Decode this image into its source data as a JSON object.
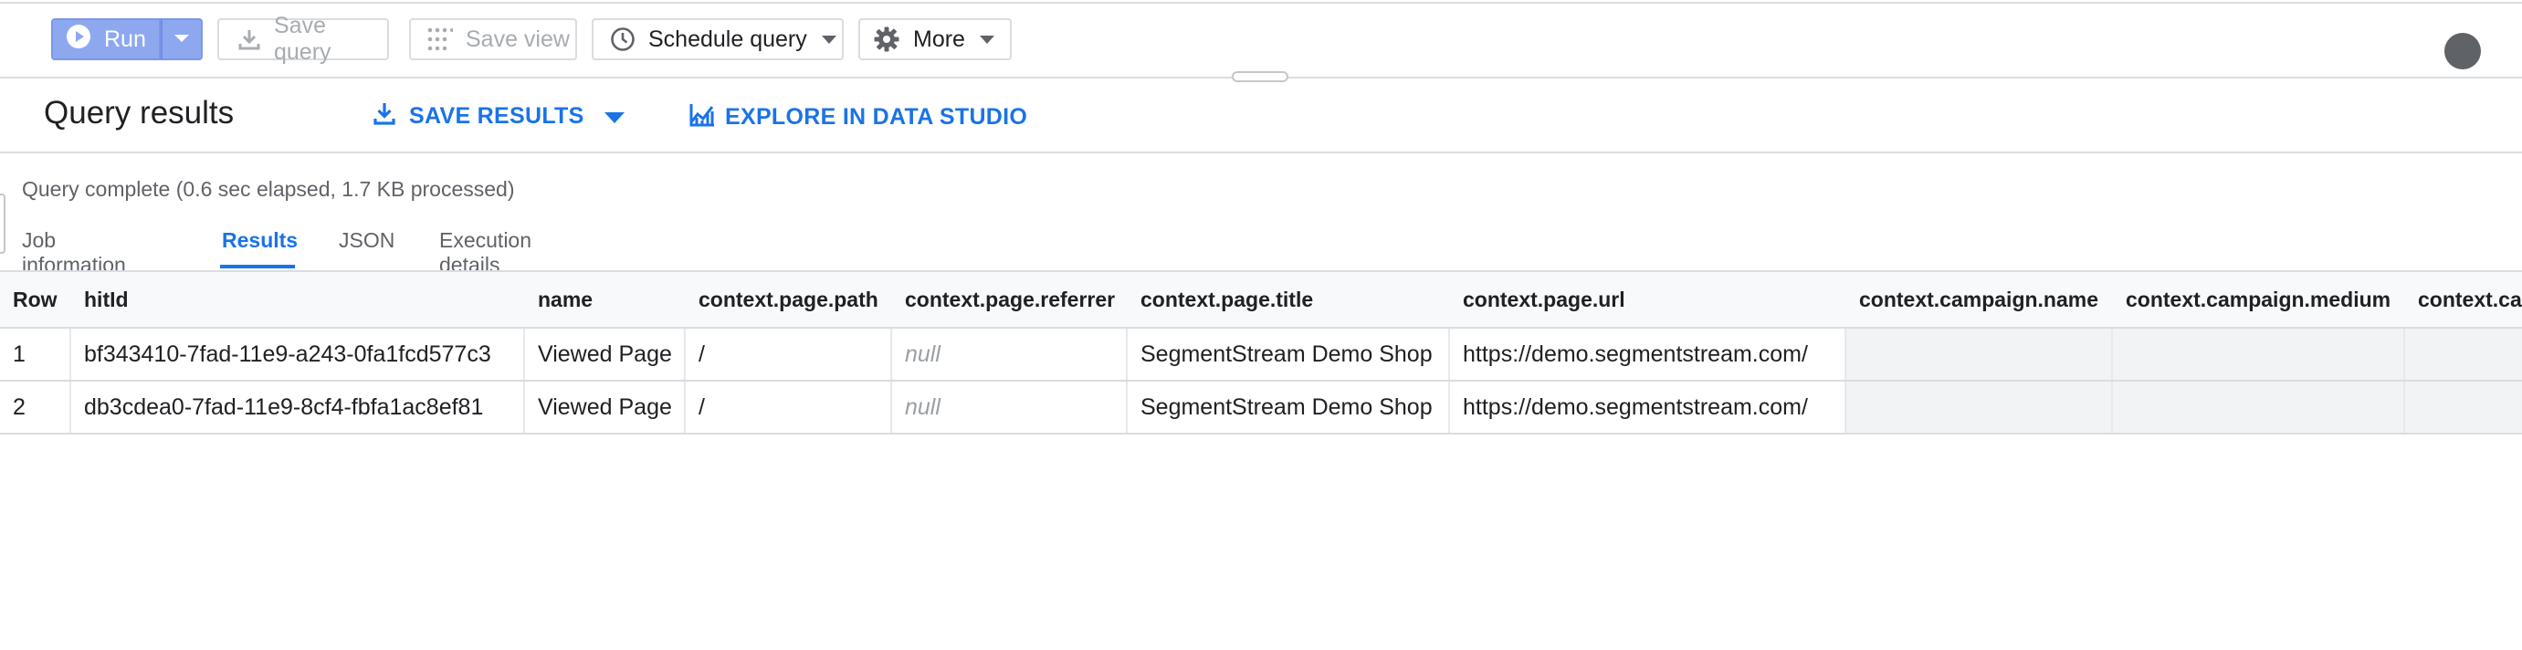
{
  "toolbar": {
    "run_label": "Run",
    "save_query_label": "Save query",
    "save_view_label": "Save view",
    "schedule_label": "Schedule query",
    "more_label": "More"
  },
  "results_header": {
    "title": "Query results",
    "save_results_label": "SAVE RESULTS",
    "explore_label": "EXPLORE IN DATA STUDIO"
  },
  "status_text": "Query complete (0.6 sec elapsed, 1.7 KB processed)",
  "tabs": [
    {
      "label": "Job information"
    },
    {
      "label": "Results"
    },
    {
      "label": "JSON"
    },
    {
      "label": "Execution details"
    }
  ],
  "active_tab": "Results",
  "table": {
    "columns": [
      "Row",
      "hitId",
      "name",
      "context.page.path",
      "context.page.referrer",
      "context.page.title",
      "context.page.url",
      "context.campaign.name",
      "context.campaign.medium",
      "context.ca"
    ],
    "rows": [
      [
        "1",
        "bf343410-7fad-11e9-a243-0fa1fcd577c3",
        "Viewed Page",
        "/",
        "null",
        "SegmentStream Demo Shop",
        "https://demo.segmentstream.com/",
        "",
        "",
        ""
      ],
      [
        "2",
        "db3cdea0-7fad-11e9-8cf4-fbfa1ac8ef81",
        "Viewed Page",
        "/",
        "null",
        "SegmentStream Demo Shop",
        "https://demo.segmentstream.com/",
        "",
        "",
        ""
      ]
    ]
  },
  "colors": {
    "accent": "#1a73e8",
    "run_button": "#8ea8f0",
    "border": "#dadce0",
    "null_text": "#9aa0a6"
  }
}
